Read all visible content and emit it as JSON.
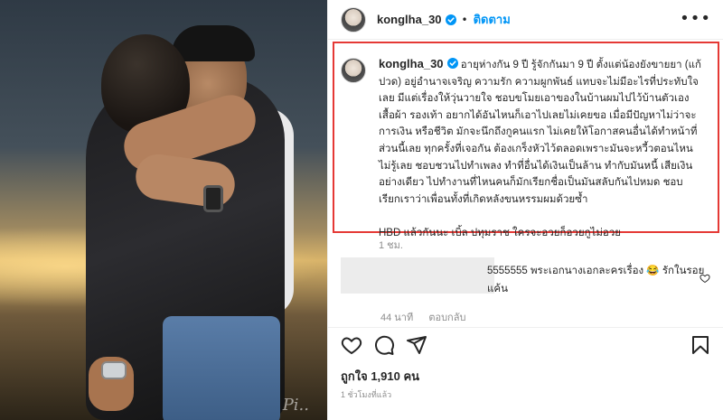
{
  "post": {
    "username": "konglha_30",
    "follow_label": "ติดตาม",
    "more_label": "•••",
    "dot": "•"
  },
  "caption": {
    "username": "konglha_30",
    "text": "อายุห่างกัน 9 ปี รู้จักกันมา 9 ปี ตั้งแต่น้องยังขายยา (แก้ปวด) อยู่อำนาจเจริญ ความรัก ความผูกพันธ์ แทบจะไม่มีอะไรที่ประทับใจเลย มีแต่เรื่องให้วุ่นวายใจ ชอบขโมยเอาของในบ้านผมไปไว้บ้านตัวเอง เสื้อผ้า รองเท้า อยากได้อันไหนก็เอาไปเลยไม่เคยขอ เมื่อมีปัญหาไม่ว่าจะการเงิน หรือชีวิต มักจะนึกถึงกูคนแรก ไม่เคยให้โอกาสคนอื่นได้ทำหน้าที่ส่วนนี้เลย ทุกครั้งที่เจอกัน ต้องเกร็งหัวไว้ตลอดเพราะมันจะหวี้วตอนไหนไม่รู้เลย ชอบชวนไปทำเพลง ทำที่อื่นได้เงินเป็นล้าน ทำกับมันหนี้ เสียเงินอย่างเดียว ไปทำงานที่ไหนคนก็มักเรียกชื่อเป็นมันสลับกันไปหมด ชอบเรียกเราว่าเพื่อนทั้งที่เกิดหลังขนหรรมผมด้วยซ้ำ",
    "text2": "HBD แล้วกันนะ เบิ้ล ปทุมราช ใครจะอวยก็อวยกูไม่อวย",
    "time": "1 ชม."
  },
  "comment": {
    "text": "5555555 พระเอกนางเอกละครเรื่อง 😂 รักในรอยแค้น",
    "time": "44 นาที",
    "reply_label": "ตอบกลับ"
  },
  "footer": {
    "likes": "ถูกใจ 1,910 คน",
    "time": "1 ชั่วโมงที่แล้ว"
  },
  "photo": {
    "signature": "Pi.."
  },
  "colors": {
    "accent": "#0095f6",
    "highlight": "#e53935",
    "verified": "#0095f6"
  },
  "icons": [
    "verified-badge-icon",
    "more-icon",
    "heart-icon",
    "comment-icon",
    "share-icon",
    "bookmark-icon"
  ]
}
